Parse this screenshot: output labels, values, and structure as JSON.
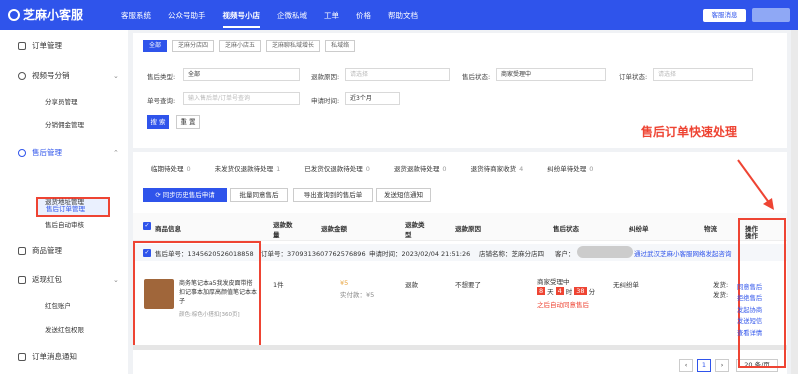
{
  "app": {
    "logo": "芝麻小客服"
  },
  "topnav": [
    "客服系统",
    "公众号助手",
    "视频号小店",
    "企微私域",
    "工单",
    "价格",
    "帮助文档"
  ],
  "topnav_active": 2,
  "help_button": "客服消息",
  "sidebar": {
    "order_mgmt": "订单管理",
    "video_dist": "视频号分销",
    "dist_mgmt": "分享员管理",
    "dist_comm": "分销佣金管理",
    "aftersale": "售后管理",
    "aftersale_orders": "售后订单管理",
    "return_addr": "退货地址管理",
    "auto_review": "售后自动审核",
    "goods": "商品管理",
    "redpack": "返现红包",
    "redpack_acct": "红包账户",
    "redpack_perm": "发送红包权限",
    "order_notify": "订单消息通知"
  },
  "filter_tags": [
    "全部",
    "芝麻分店四",
    "芝麻小店五",
    "芝麻聊私域增长",
    "私域络"
  ],
  "filters": {
    "type_label": "售后类型:",
    "type_value": "全部",
    "reason_label": "退款原因:",
    "reason_ph": "请选择",
    "status_label": "售后状态:",
    "status_value": "商家受理中",
    "order_status_label": "订单状态:",
    "order_status_ph": "请选择",
    "order_no_label": "单号查询:",
    "order_no_ph": "输入售后单/订单号查询",
    "apply_time_label": "申请时间:",
    "apply_time_value": "近3个月"
  },
  "search_btn": "搜 索",
  "reset_btn": "重 置",
  "annotation": "售后订单快速处理",
  "subtabs": [
    {
      "label": "临期待处理",
      "count": "0"
    },
    {
      "label": "未发货仅退款待处理",
      "count": "1"
    },
    {
      "label": "已发货仅退款待处理",
      "count": "0"
    },
    {
      "label": "退货退款待处理",
      "count": "0"
    },
    {
      "label": "退货待商家收货",
      "count": "4"
    },
    {
      "label": "纠纷单待处理",
      "count": "0"
    }
  ],
  "actions": {
    "sync": "同步历史售后申请",
    "batch_agree": "批量同意售后",
    "export": "导出查询到的售后单",
    "sms": "发送短信通知"
  },
  "columns": [
    "商品信息",
    "退款数量",
    "退款金额",
    "退款类型",
    "退款原因",
    "售后状态",
    "纠纷单",
    "物流",
    "操作"
  ],
  "order": {
    "aftersale_no": "售后单号：1345620526018858",
    "order_no": "订单号：3709313607762576896",
    "apply_time": "申请时间：2023/02/04 21:51:26",
    "shop": "店铺名称：芝麻分店四",
    "customer": "客户：",
    "via": "通过武汉芝麻小客服网络发起咨询"
  },
  "product": {
    "title": "商务笔记本a5我发皮面带搭扣记事本加厚高颜值笔记本本子",
    "sku": "颜色:棕色小搭扣[360页]"
  },
  "row": {
    "qty": "1件",
    "amount": "¥5",
    "paid": "实付款：¥5",
    "type": "退款",
    "reason": "不想要了",
    "status": "商家受理中",
    "d": "8",
    "d_unit": "天",
    "h": "4",
    "h_unit": "时",
    "m": "38",
    "m_unit": "分",
    "auto": "之后自动同意售后",
    "dispute": "无纠纷单",
    "logi1": "发货:",
    "logi2": "发货:"
  },
  "ops": [
    "同意售后",
    "拒绝售后",
    "发起协商",
    "发送短信",
    "查看详情"
  ],
  "pager": {
    "page": "1",
    "size": "20 条/页"
  }
}
